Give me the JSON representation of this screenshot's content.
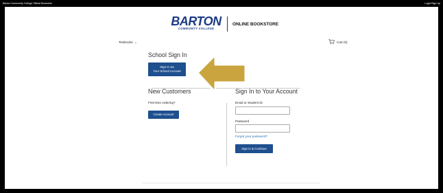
{
  "topbar": {
    "left_text": "Barton Community College Official Bookstore",
    "right_text": "Login/Sign Up"
  },
  "header": {
    "logo_word": "BARTON",
    "logo_subtitle": "COMMUNITY COLLEGE",
    "store_name": "ONLINE BOOKSTORE",
    "brand_color": "#1b3a84"
  },
  "nav": {
    "textbooks_label": "Textbooks",
    "cart_label": "Cart (0)"
  },
  "school_signin": {
    "title": "School Sign In",
    "button_line1": "Sign In via",
    "button_line2": "Your School Account"
  },
  "new_customers": {
    "title": "New Customers",
    "prompt": "First time ordering?",
    "create_button": "Create Account"
  },
  "account_signin": {
    "title": "Sign In to Your Account",
    "email_label": "Email or Student ID",
    "email_value": "",
    "password_label": "Password",
    "password_value": "",
    "forgot_link": "Forgot your password?",
    "submit_button": "Sign In & Continue"
  },
  "annotation": {
    "arrow_color": "#c9a43f",
    "arrow_icon": "arrow-left-icon"
  }
}
